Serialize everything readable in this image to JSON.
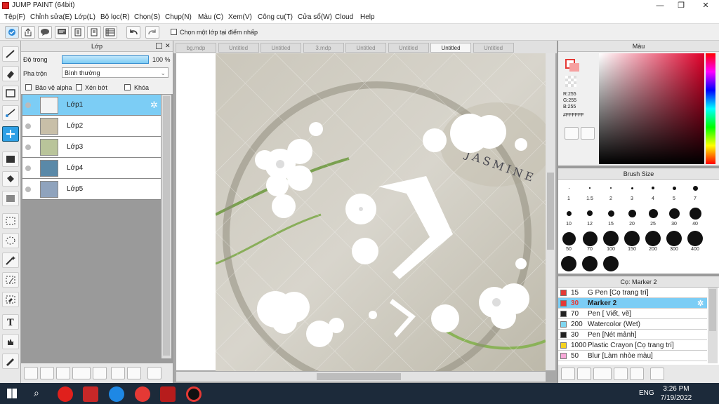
{
  "app": {
    "title": "JUMP PAINT (64bit)"
  },
  "menu": [
    "Tệp(F)",
    "Chỉnh sửa(E)",
    "Lớp(L)",
    "Bộ lọc(R)",
    "Chọn(S)",
    "Chụp(N)",
    "Màu (C)",
    "Xem(V)",
    "Công cụ(T)",
    "Cửa sổ(W)",
    "Cloud",
    "Help"
  ],
  "toolbar": {
    "select_layer_label": "Chọn một lớp tại điểm nhấp"
  },
  "layer_panel": {
    "title": "Lớp",
    "opacity_label": "Độ trong",
    "opacity_value": "100 %",
    "opacity_fraction": 1.0,
    "blend_label": "Pha trộn",
    "blend_value": "Bình thường",
    "protect_alpha": "Bảo vệ alpha",
    "clip": "Xén bớt",
    "lock": "Khóa",
    "layers": [
      {
        "name": "Lớp1",
        "selected": true,
        "thumb": "#f4f4f4"
      },
      {
        "name": "Lớp2",
        "selected": false,
        "thumb": "#c8bfa8"
      },
      {
        "name": "Lớp3",
        "selected": false,
        "thumb": "#b9c49a"
      },
      {
        "name": "Lớp4",
        "selected": false,
        "thumb": "#5a89a8"
      },
      {
        "name": "Lớp5",
        "selected": false,
        "thumb": "#8fa3bd"
      }
    ]
  },
  "tabs": [
    "bg.mdp",
    "Untitled",
    "Untitled",
    "3.mdp",
    "Untitled",
    "Untitled",
    "Untitled",
    "Untitled"
  ],
  "active_tab_index": 6,
  "canvas": {
    "watermark": "JASMINE"
  },
  "color_panel": {
    "title": "Màu",
    "r": "R:255",
    "g": "G:255",
    "b": "B:255",
    "hex": "#FFFFFF",
    "primary": "#e53935",
    "secondary": "#ffffff"
  },
  "brush_size": {
    "title": "Brush Size",
    "sizes": [
      "1",
      "1.5",
      "2",
      "3",
      "4",
      "5",
      "7",
      "10",
      "12",
      "15",
      "20",
      "25",
      "30",
      "40",
      "50",
      "70",
      "100",
      "150",
      "200",
      "300",
      "400",
      "",
      "",
      ""
    ]
  },
  "brush_panel": {
    "title": "Cọ: Marker 2",
    "brushes": [
      {
        "size": "15",
        "name": "G Pen [Cọ trang trí]",
        "color": "#e53935",
        "selected": false
      },
      {
        "size": "30",
        "name": "Marker 2",
        "color": "#e53935",
        "selected": true
      },
      {
        "size": "70",
        "name": "Pen [ Viết, vẽ]",
        "color": "#222222",
        "selected": false
      },
      {
        "size": "200",
        "name": "Watercolor (Wet)",
        "color": "#7fd6f0",
        "selected": false
      },
      {
        "size": "30",
        "name": "Pen [Nét mảnh]",
        "color": "#222222",
        "selected": false
      },
      {
        "size": "1000",
        "name": "Plastic Crayon [Cọ trang trí]",
        "color": "#f4d21f",
        "selected": false
      },
      {
        "size": "50",
        "name": "Blur [Làm nhòe màu]",
        "color": "#f7a8d8",
        "selected": false
      }
    ]
  },
  "taskbar": {
    "time": "3:26 PM",
    "date": "7/19/2022",
    "lang": "ENG"
  }
}
